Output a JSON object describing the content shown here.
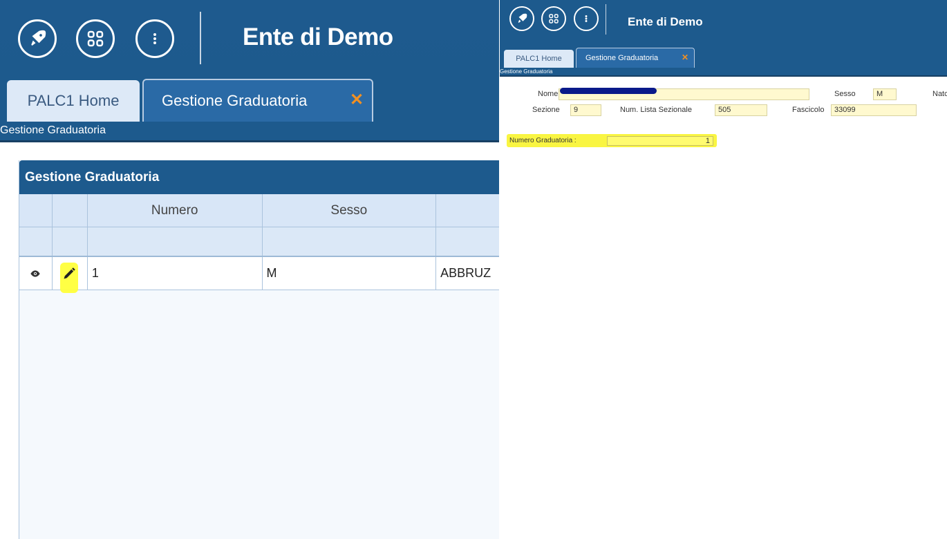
{
  "app": {
    "title": "Ente di Demo"
  },
  "tabs": {
    "home_label": "PALC1 Home",
    "active_label": "Gestione Graduatoria",
    "close_glyph": "✕"
  },
  "breadcrumb": "Gestione Graduatoria",
  "grid": {
    "title": "Gestione Graduatoria",
    "columns": [
      "",
      "",
      "Numero",
      "Sesso",
      ""
    ],
    "rows": [
      {
        "numero": "1",
        "sesso": "M",
        "cognome": "ABBRUZ"
      }
    ]
  },
  "form": {
    "nome_label": "Nome",
    "sesso_label": "Sesso",
    "sesso_value": "M",
    "nato_label": "Natc",
    "sezione_label": "Sezione",
    "sezione_value": "9",
    "num_lista_label": "Num. Lista Sezionale",
    "num_lista_value": "505",
    "fascicolo_label": "Fascicolo",
    "fascicolo_value": "33099",
    "numero_graduatoria_label": "Numero Graduatoria :",
    "numero_graduatoria_value": "1"
  },
  "icons": {
    "rocket": "rocket-icon",
    "apps": "apps-grid-icon",
    "more": "more-vertical-icon",
    "view": "eye-icon",
    "edit": "pencil-icon"
  },
  "colors": {
    "header_blue": "#1d5a8d",
    "highlight_yellow": "#ffff3a",
    "close_orange": "#f29022"
  }
}
